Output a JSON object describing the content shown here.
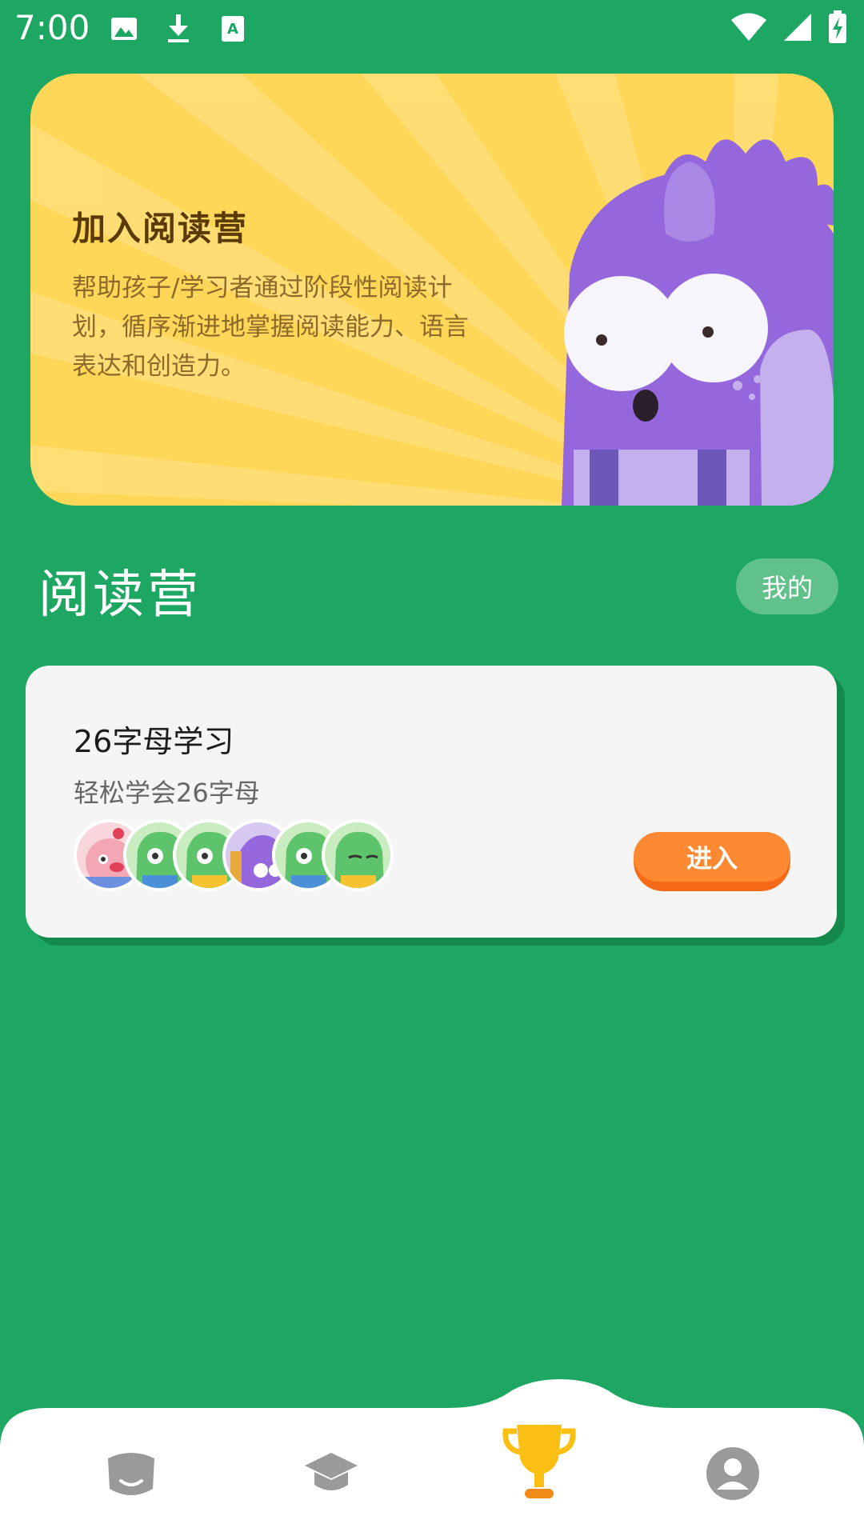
{
  "status_bar": {
    "time": "7:00",
    "left_icons": [
      "image-icon",
      "download-icon",
      "text-a-icon"
    ],
    "right_icons": [
      "wifi-icon",
      "signal-icon",
      "battery-charging-icon"
    ]
  },
  "banner": {
    "title": "加入阅读营",
    "description": "帮助孩子/学习者通过阶段性阅读计划，循序渐进地掌握阅读能力、语言表达和创造力。",
    "mascot": "purple-monster-illustration",
    "colors": {
      "background": "#fed658",
      "ray": "#ffdf76"
    }
  },
  "section": {
    "title": "阅读营",
    "mine_label": "我的"
  },
  "course": {
    "title": "26字母学习",
    "subtitle": "轻松学会26字母",
    "enter_label": "进入",
    "avatars": [
      "pink-pig-avatar",
      "green-dino-avatar",
      "green-dino-avatar",
      "purple-monster-avatar",
      "green-dino-avatar",
      "green-dino-sleepy-avatar"
    ]
  },
  "bottom_nav": {
    "items": [
      {
        "name": "home",
        "icon": "face-icon"
      },
      {
        "name": "courses",
        "icon": "graduation-cap-icon"
      },
      {
        "name": "camp",
        "icon": "trophy-icon",
        "active": true
      },
      {
        "name": "profile",
        "icon": "user-icon"
      }
    ]
  },
  "colors": {
    "page_background": "#1ea762",
    "accent_orange": "#fd8a33",
    "active_nav": "#fbbf13",
    "inactive_nav": "#9a9a9a"
  }
}
